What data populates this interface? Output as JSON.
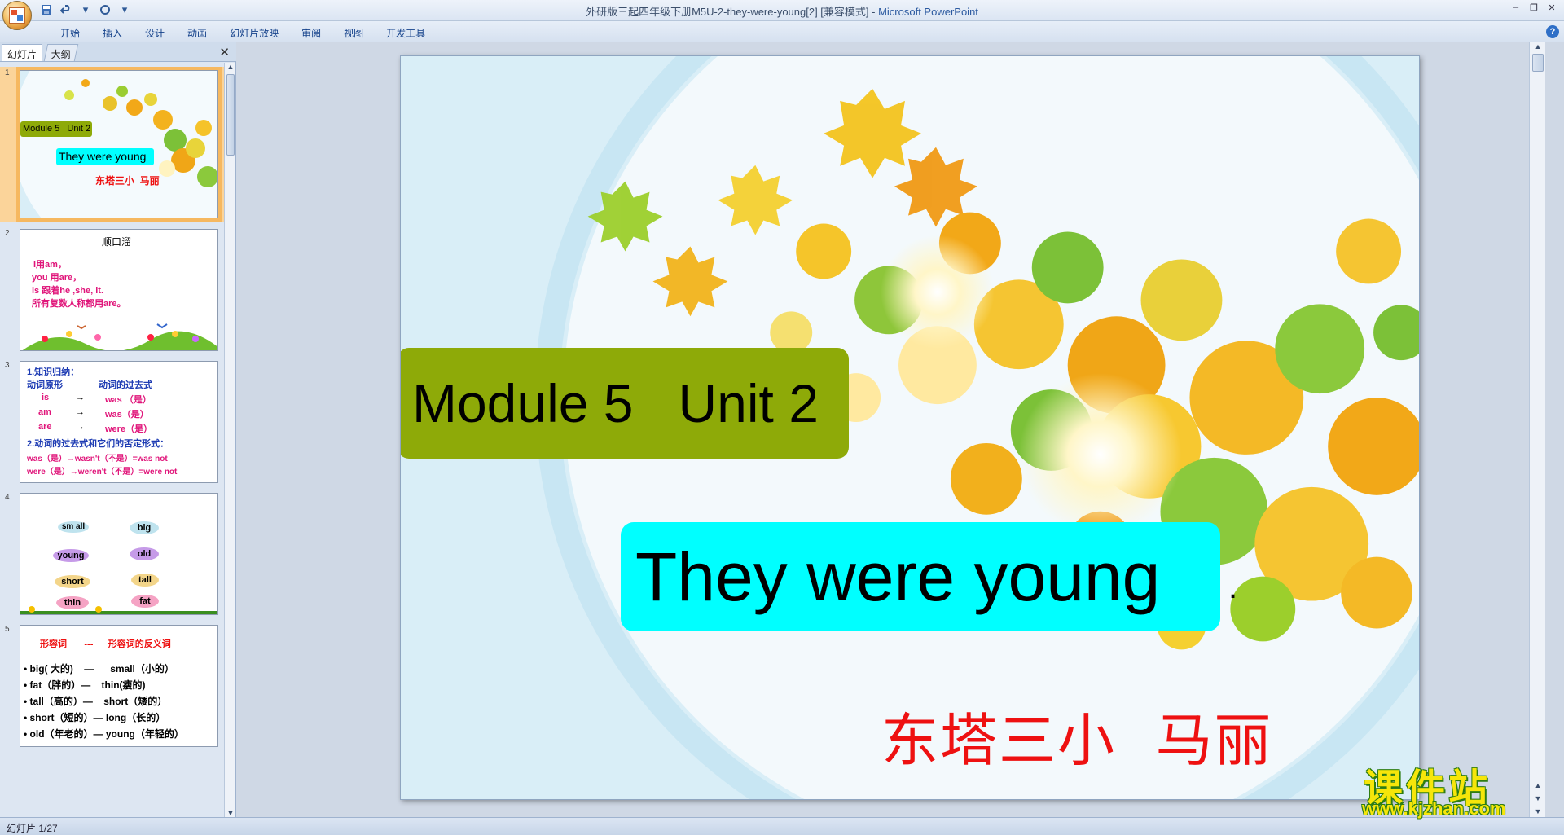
{
  "window": {
    "title": "外研版三起四年级下册M5U-2-they-were-young[2] [兼容模式] - ",
    "app_name": "Microsoft PowerPoint"
  },
  "ribbon": {
    "tabs": [
      "开始",
      "插入",
      "设计",
      "动画",
      "幻灯片放映",
      "审阅",
      "视图",
      "开发工具"
    ]
  },
  "left_pane": {
    "tab_slides": "幻灯片",
    "tab_outline": "大纲"
  },
  "thumbnails": [
    {
      "number": "1",
      "module_text": "Module 5   Unit 2",
      "title_text": "They were young",
      "author_text": "东塔三小  马丽"
    },
    {
      "number": "2",
      "heading": "顺口溜",
      "lines": [
        "I用am，",
        "you 用are，",
        "is 跟着he ,she, it.",
        "所有复数人称都用are。"
      ]
    },
    {
      "number": "3",
      "line1": "1.知识归纳：",
      "header_left": "动词原形",
      "header_right": "动词的过去式",
      "pairs": [
        {
          "base": "is",
          "arrow": "→",
          "past": "was （是）"
        },
        {
          "base": "am",
          "arrow": "→",
          "past": "was（是）"
        },
        {
          "base": "are",
          "arrow": "→",
          "past": "were（是）"
        }
      ],
      "line2": "2.动词的过去式和它们的否定形式：",
      "neg1": "was（是）→wasn't（不是）=was not",
      "neg2": "were（是）→weren't（不是）=were not"
    },
    {
      "number": "4",
      "words_left": [
        "sm all",
        "young",
        "short",
        "thin"
      ],
      "words_right": [
        "big",
        "old",
        "tall",
        "fat"
      ]
    },
    {
      "number": "5",
      "heading": "形容词       ---      形容词的反义词",
      "lines": [
        "• big( 大的)    —      small（小的）",
        "• fat（胖的）—    thin(瘦的)",
        "• tall（高的）—    short（矮的）",
        "• short（短的）— long（长的）",
        "• old（年老的）— young（年轻的）"
      ]
    }
  ],
  "slide": {
    "module_text": "Module 5   Unit 2",
    "title_text": "They were young",
    "title_dot": ".",
    "author_text": "东塔三小  马丽"
  },
  "status": {
    "slide_counter": "幻灯片 1/27"
  },
  "watermark": {
    "brand": "课件站",
    "url": "www.kjzhan.com"
  },
  "colors": {
    "module_box": "#8eaa08",
    "title_box": "#00ffff",
    "author_text": "#ee1111",
    "thumb_selected_outline": "#f6b860"
  },
  "icons": {
    "office_button": "office-logo-icon",
    "save": "save-icon",
    "undo": "undo-icon",
    "redo": "redo-icon",
    "help": "help-icon",
    "close_pane": "close-icon"
  }
}
